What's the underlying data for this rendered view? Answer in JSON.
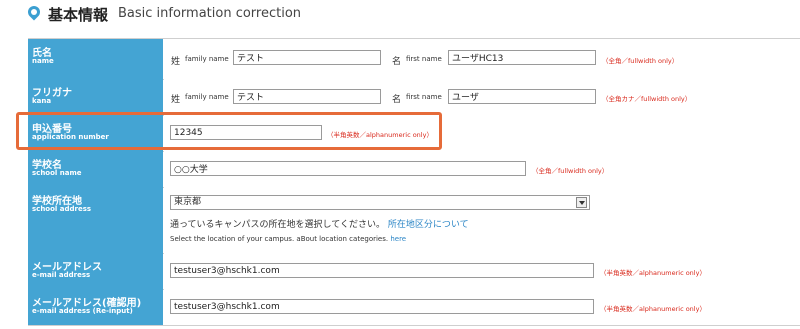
{
  "header": {
    "title_jp": "基本情報",
    "title_en": "Basic information correction"
  },
  "rows": {
    "name": {
      "label_jp": "氏名",
      "label_en": "name",
      "sei": "姓",
      "family_label": "family name",
      "family_value": "テスト",
      "mei": "名",
      "first_label": "first name",
      "first_value": "ユーザHC13",
      "note": "（全角／fullwidth only）"
    },
    "kana": {
      "label_jp": "フリガナ",
      "label_en": "kana",
      "sei": "姓",
      "family_label": "family name",
      "family_value": "テスト",
      "mei": "名",
      "first_label": "first name",
      "first_value": "ユーザ",
      "note": "（全角カナ／fullwidth only）"
    },
    "application": {
      "label_jp": "申込番号",
      "label_en": "application number",
      "value": "12345",
      "note": "（半角英数／alphanumeric only）"
    },
    "school": {
      "label_jp": "学校名",
      "label_en": "school name",
      "value": "○○大学",
      "note": "（全角／fullwidth only）"
    },
    "address": {
      "label_jp": "学校所在地",
      "label_en": "school address",
      "selected": "東京都",
      "help_jp": "通っているキャンパスの所在地を選択してください。",
      "help_jp_link": "所在地区分について",
      "help_en": "Select the location of your campus. aBout location categories.",
      "help_en_link": "here"
    },
    "email": {
      "label_jp": "メールアドレス",
      "label_en": "e-mail address",
      "value": "testuser3@hschk1.com",
      "note": "（半角英数／alphanumeric only）"
    },
    "email_confirm": {
      "label_jp": "メールアドレス(確認用)",
      "label_en": "e-mail address (Re-input)",
      "value": "testuser3@hschk1.com",
      "note": "（半角英数／alphanumeric only）"
    }
  },
  "colors": {
    "label_bg": "#44a4d3",
    "note": "#d9291c",
    "highlight": "#e66b39",
    "link": "#2c86c6"
  }
}
